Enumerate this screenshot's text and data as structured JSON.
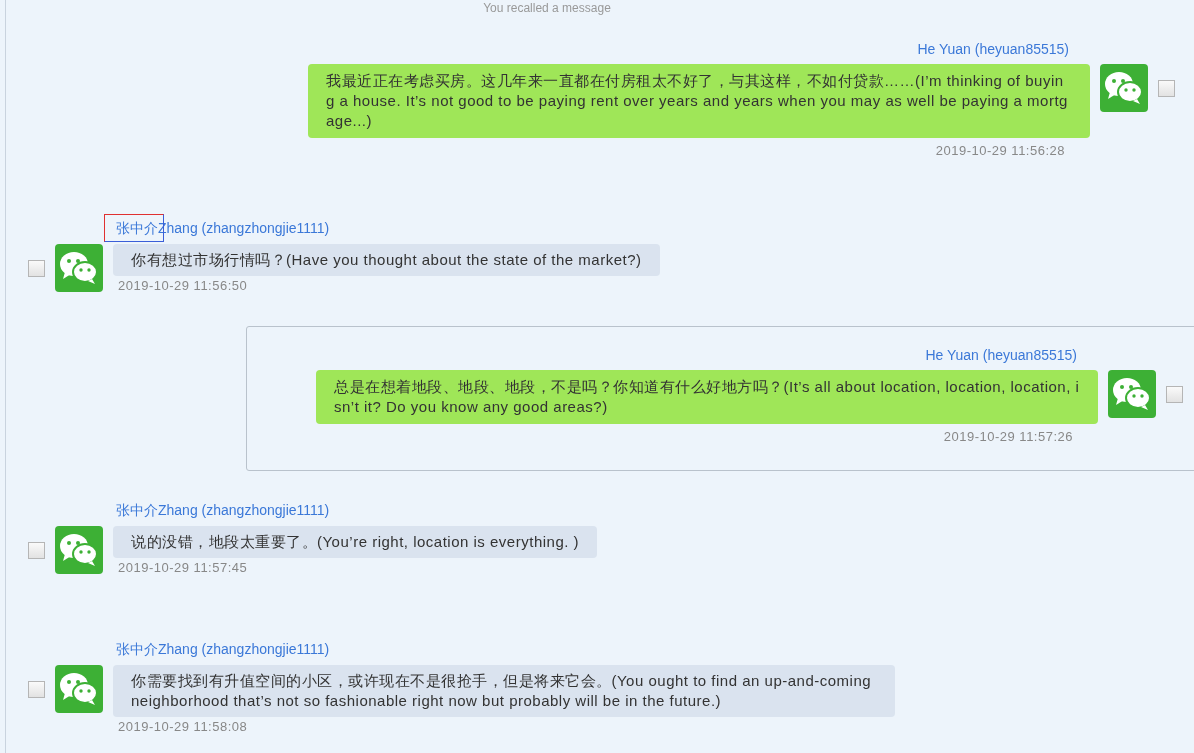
{
  "notice": "You recalled a message",
  "messages": [
    {
      "kind": "outgoing",
      "sender": "He Yuan (heyuan85515)",
      "text": "我最近正在考虑买房。这几年来一直都在付房租太不好了，与其这样，不如付贷款……(I’m thinking of buying a house. It’s not good to be paying rent over years and years when you may as well be paying a mortgage...)",
      "time": "2019-10-29 11:56:28",
      "checked": false,
      "selected": false,
      "name_marked": false
    },
    {
      "kind": "incoming",
      "sender": "张中介Zhang (zhangzhongjie1111)",
      "text": "你有想过市场行情吗？(Have you thought about the state of the market?)",
      "time": "2019-10-29 11:56:50",
      "checked": false,
      "selected": false,
      "name_marked": true
    },
    {
      "kind": "outgoing",
      "sender": "He Yuan (heyuan85515)",
      "text": "总是在想着地段、地段、地段，不是吗？你知道有什么好地方吗？(It’s all about location, location, location, isn’t it? Do you know any good areas?)",
      "time": "2019-10-29 11:57:26",
      "checked": false,
      "selected": true,
      "name_marked": false
    },
    {
      "kind": "incoming",
      "sender": "张中介Zhang (zhangzhongjie1111)",
      "text": "说的没错，地段太重要了。(You’re right, location is everything. )",
      "time": "2019-10-29 11:57:45",
      "checked": false,
      "selected": false,
      "name_marked": false
    },
    {
      "kind": "incoming",
      "sender": "张中介Zhang (zhangzhongjie1111)",
      "text": "你需要找到有升值空间的小区，或许现在不是很抢手，但是将来它会。(You ought to find an up-and-coming neighborhood that’s not so fashionable right now but probably will be in the future.)",
      "time": "2019-10-29 11:58:08",
      "checked": false,
      "selected": false,
      "name_marked": false
    }
  ]
}
